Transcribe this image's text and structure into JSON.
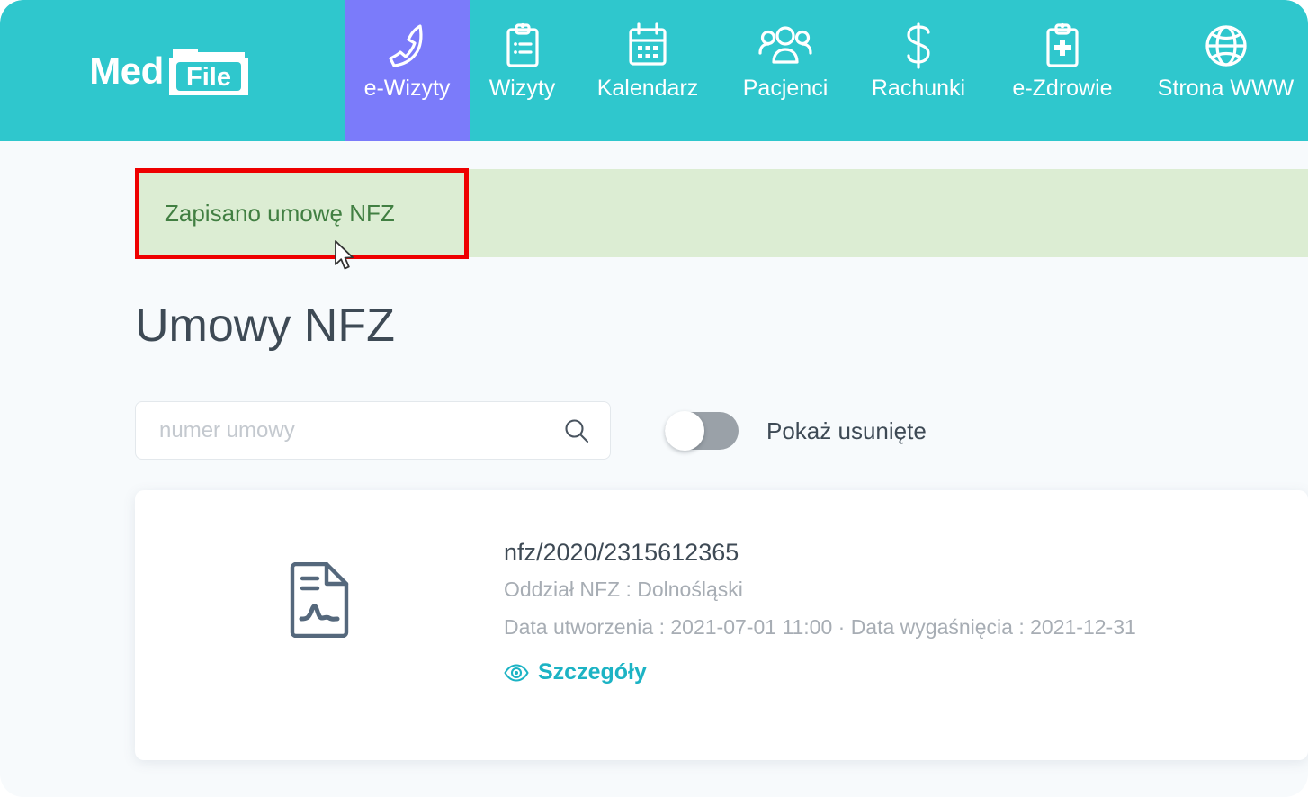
{
  "brand": {
    "name_part1": "Med",
    "name_part2": "File"
  },
  "nav": {
    "items": [
      {
        "label": "e-Wizyty",
        "icon": "phone-call-icon",
        "active": true
      },
      {
        "label": "Wizyty",
        "icon": "clipboard-list-icon",
        "active": false
      },
      {
        "label": "Kalendarz",
        "icon": "calendar-icon",
        "active": false
      },
      {
        "label": "Pacjenci",
        "icon": "people-group-icon",
        "active": false
      },
      {
        "label": "Rachunki",
        "icon": "dollar-sign-icon",
        "active": false
      },
      {
        "label": "e-Zdrowie",
        "icon": "clipboard-plus-icon",
        "active": false
      },
      {
        "label": "Strona WWW",
        "icon": "globe-icon",
        "active": false
      }
    ]
  },
  "alert": {
    "message": "Zapisano umowę NFZ",
    "background_color": "#dcedd3",
    "text_color": "#417f42",
    "annotation_color": "#ee0000"
  },
  "page": {
    "title": "Umowy NFZ"
  },
  "search": {
    "placeholder": "numer umowy",
    "value": "",
    "icon": "search-icon"
  },
  "toggle": {
    "label": "Pokaż usunięte",
    "state": "off",
    "track_color": "#9aa1a8"
  },
  "contracts": [
    {
      "icon": "document-signature-icon",
      "number": "nfz/2020/2315612365",
      "branch": "Oddział NFZ : Dolnośląski",
      "dates": "Data utworzenia : 2021-07-01 11:00 · Data wygaśnięcia : 2021-12-31",
      "details_label": "Szczegóły",
      "details_icon": "eye-icon"
    }
  ],
  "theme": {
    "nav_background": "#2fc7cd",
    "nav_active_background": "#7b7bfa",
    "page_background": "#f7fafc",
    "accent": "#1cb3c4",
    "text_primary": "#3e4a55",
    "text_muted": "#a7adb4"
  }
}
